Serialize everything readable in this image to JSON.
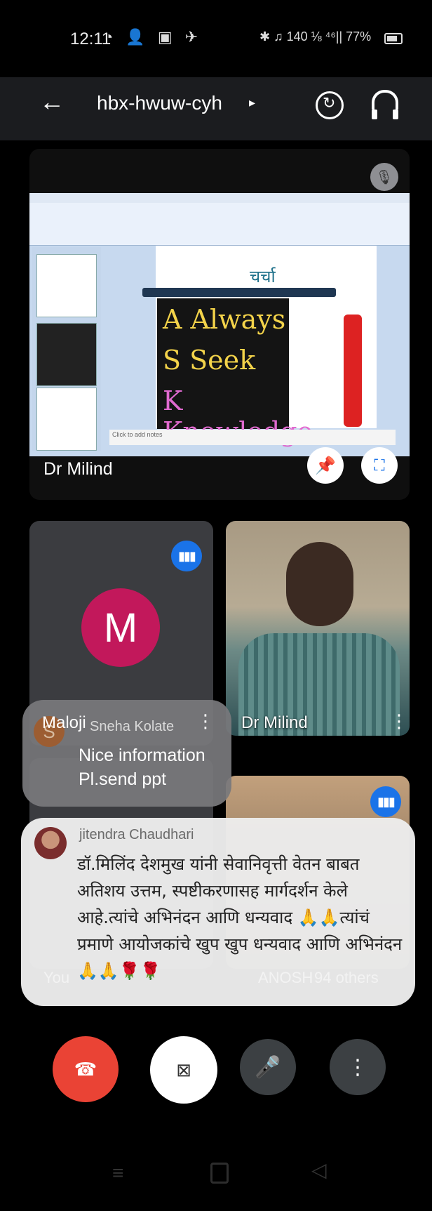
{
  "status_bar": {
    "time": "12:11",
    "left_icons": "◔ 👤 ▣ ✈",
    "right_text": "✱ ♫ 140 ⅛ ⁴⁶|| 77%"
  },
  "header": {
    "back_icon": "←",
    "meeting_code": "hbx-hwuw-cyh",
    "caret": "▸"
  },
  "main_tile": {
    "presenter_name": "Dr Milind",
    "slide_heading": "चर्चा",
    "chalk_lines": [
      "A Always",
      "S Seek",
      "K Knowledge"
    ],
    "notes_placeholder": "Click to add notes",
    "mic_muted_icon": "🎙",
    "pin_icon": "📌",
    "fullscreen_icon": "⛶"
  },
  "tiles": {
    "maloji": {
      "name": "Maloji",
      "initial": "M"
    },
    "video": {
      "name": "Dr Milind"
    },
    "bottom_left": {
      "name": "You"
    },
    "bottom_right": {
      "name": "ANOSH",
      "others": "94 others"
    }
  },
  "chat": {
    "message1": {
      "avatar_initial": "S",
      "sender": "Sneha Kolate",
      "lines": [
        "Nice information",
        "Pl.send ppt"
      ]
    },
    "message2": {
      "sender": "jitendra Chaudhari",
      "lines": [
        "डॉ.मिलिंद देशमुख यांनी सेवानिवृत्ती वेतन बाबत",
        "अतिशय उत्तम, स्पष्टीकरणासह मार्गदर्शन केले",
        "आहे.त्यांचे अभिनंदन आणि धन्यवाद 🙏🙏त्यांचं",
        "प्रमाणे आयोजकांचे खुप खुप धन्यवाद आणि अभिनंदन",
        "🙏🙏🌹🌹"
      ]
    }
  },
  "controls": {
    "end_call_icon": "☎",
    "camera_off_icon": "⊠",
    "mic_icon": "🎤",
    "more_icon": "⋮"
  },
  "navbar": {
    "menu": "≡",
    "back": "◁"
  },
  "colors": {
    "accent": "#1a73e8",
    "end_call": "#ea4335",
    "avatar_m": "#c2185b"
  }
}
